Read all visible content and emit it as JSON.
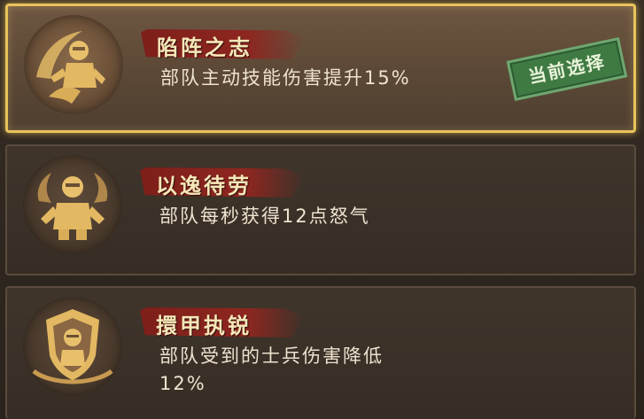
{
  "skills": [
    {
      "title": "陷阵之志",
      "description_lines": [
        "部队主动技能伤害提升15%"
      ],
      "icon": "charging-soldier-icon",
      "selected": true,
      "badge": "当前选择"
    },
    {
      "title": "以逸待劳",
      "description_lines": [
        "部队每秒获得12点怒气"
      ],
      "icon": "resting-soldier-icon",
      "selected": false
    },
    {
      "title": "擐甲执锐",
      "description_lines": [
        "部队受到的士兵伤害降低",
        "12%"
      ],
      "icon": "armored-shield-icon",
      "selected": false
    }
  ],
  "colors": {
    "selected_border": "#e8c35a",
    "title_plate": "#8e2620",
    "badge_green": "#3f7a43",
    "emblem_gold": "#e0b865"
  }
}
